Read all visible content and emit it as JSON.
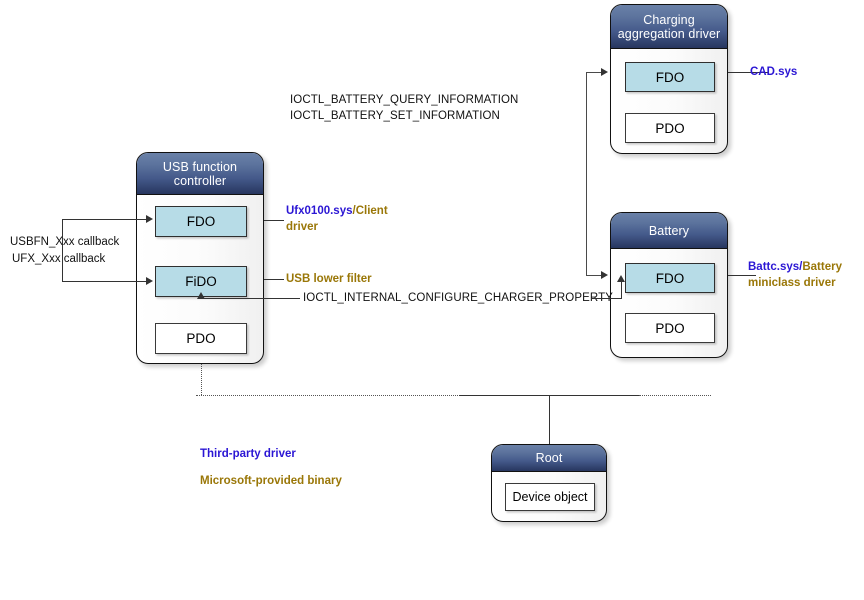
{
  "diagram": {
    "title": "USB charging driver stack diagram",
    "colors": {
      "third_party": "#2b16d4",
      "microsoft": "#9a7708",
      "device_object_fill": "#b7dce7",
      "header_gradient_top": "#6a81a8",
      "header_gradient_bottom": "#27365f",
      "connector": "#4a4a4a"
    }
  },
  "nodes": {
    "usb_function_controller": {
      "title": "USB function controller",
      "objects": [
        {
          "label": "FDO",
          "filled": true
        },
        {
          "label": "FiDO",
          "filled": true
        },
        {
          "label": "PDO",
          "filled": false
        }
      ]
    },
    "charging_aggregation_driver": {
      "title": "Charging aggregation driver",
      "objects": [
        {
          "label": "FDO",
          "filled": true
        },
        {
          "label": "PDO",
          "filled": false
        }
      ]
    },
    "battery": {
      "title": "Battery",
      "objects": [
        {
          "label": "FDO",
          "filled": true
        },
        {
          "label": "PDO",
          "filled": false
        }
      ]
    },
    "root": {
      "title": "Root",
      "objects": [
        {
          "label": "Device object",
          "filled": false
        }
      ]
    }
  },
  "annotations": {
    "ioctl_battery_query": "IOCTL_BATTERY_QUERY_INFORMATION",
    "ioctl_battery_set": "IOCTL_BATTERY_SET_INFORMATION",
    "ioctl_internal_configure_charger": "IOCTL_INTERNAL_CONFIGURE_CHARGER_PROPERTY",
    "usbfn_callback": "USBFN_Xxx callback",
    "ufx_callback": "UFX_Xxx callback"
  },
  "driver_labels": {
    "ufx": {
      "binary": "Ufx0100.sys",
      "separator": "/",
      "role_line1": "Client",
      "role_line2": "driver"
    },
    "usb_lower_filter": {
      "text": "USB lower filter"
    },
    "cad": {
      "binary": "CAD.sys"
    },
    "battc": {
      "binary": "Battc.sys/",
      "role_line1": "Battery",
      "role_line2": "miniclass driver"
    }
  },
  "legend": {
    "third_party": "Third-party driver",
    "microsoft": "Microsoft-provided binary"
  }
}
